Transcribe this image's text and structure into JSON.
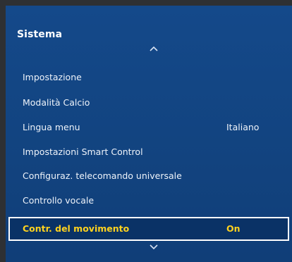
{
  "menu": {
    "title": "Sistema",
    "items": [
      {
        "label": "Impostazione",
        "value": ""
      },
      {
        "label": "Modalità Calcio",
        "value": ""
      },
      {
        "label": "Lingua menu",
        "value": "Italiano"
      },
      {
        "label": "Impostazioni Smart Control",
        "value": ""
      },
      {
        "label": "Configuraz. telecomando universale",
        "value": ""
      },
      {
        "label": "Controllo vocale",
        "value": ""
      },
      {
        "label": "Contr. del movimento",
        "value": "On",
        "selected": true
      }
    ]
  },
  "icons": {
    "scroll_up": "chevron-up-icon",
    "scroll_down": "chevron-down-icon"
  },
  "colors": {
    "panel": "#14498a",
    "selected_text": "#ffd21e",
    "text": "#eef3fa",
    "focus_border": "#ffffff"
  }
}
